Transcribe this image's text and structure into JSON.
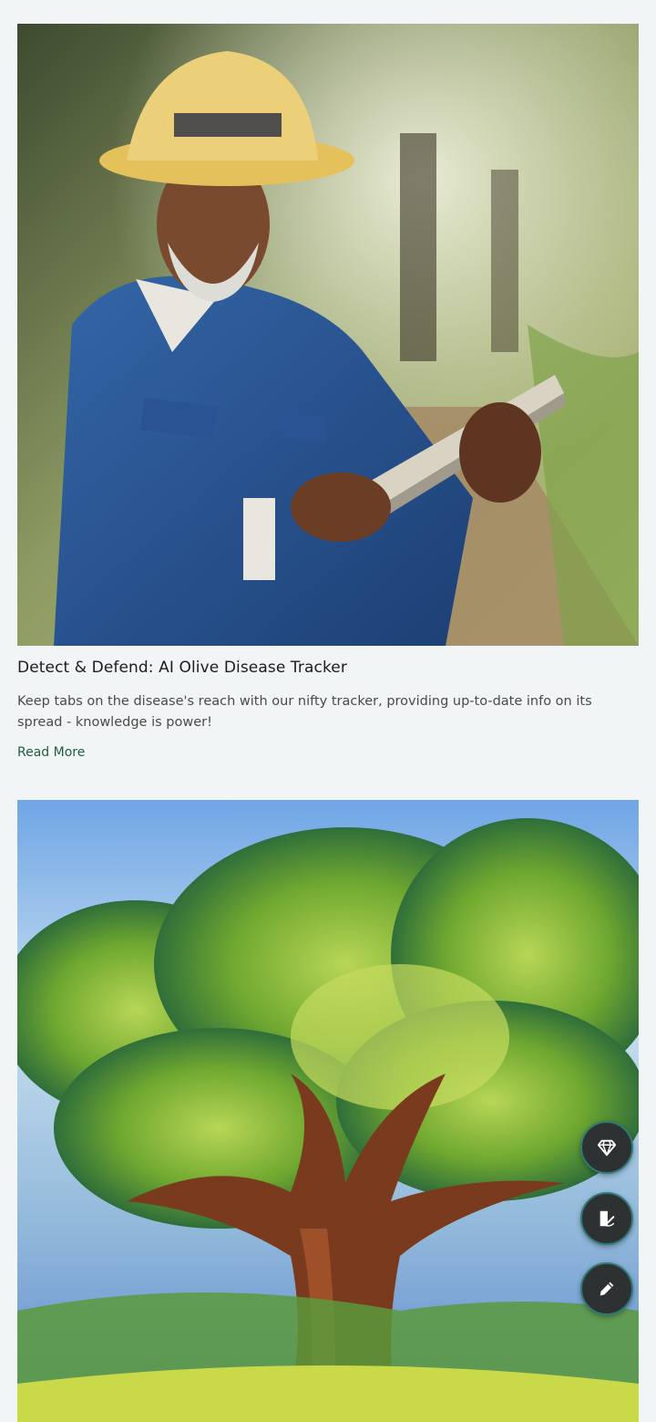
{
  "posts": [
    {
      "image_alt": "Elderly farmer in a straw hat using a tablet in an olive grove",
      "title": "Detect & Defend: AI Olive Disease Tracker",
      "excerpt": "Keep tabs on the disease's reach with our nifty tracker, providing up-to-date info on its spread - knowledge is power!",
      "link_label": "Read More"
    },
    {
      "image_alt": "Painted olive tree under a blue sky"
    }
  ],
  "floating_actions": [
    {
      "icon": "diamond-icon"
    },
    {
      "icon": "page-edit-icon"
    },
    {
      "icon": "pencil-icon"
    }
  ],
  "colors": {
    "background": "#f2f5f5",
    "link": "#1f5e3f",
    "fab_background": "#2e3132",
    "fab_border": "#2d7a77"
  }
}
